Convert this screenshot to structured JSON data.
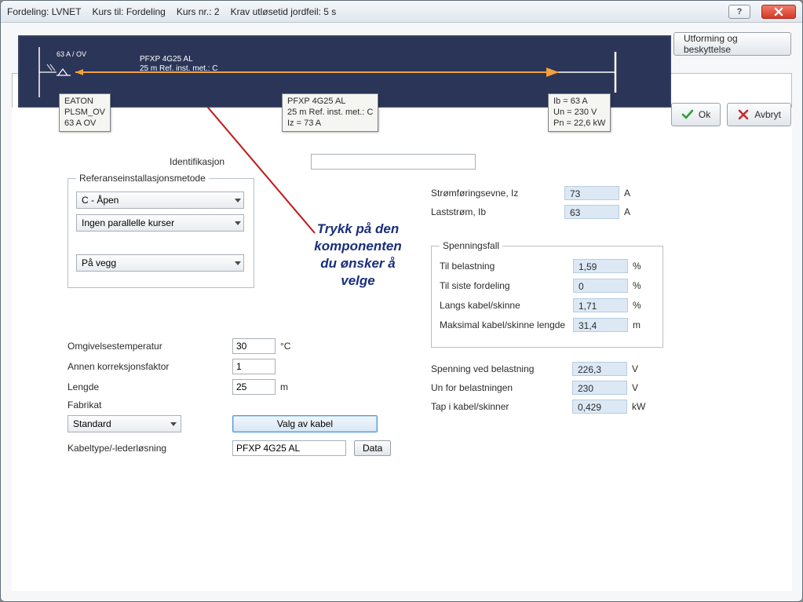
{
  "title_parts": {
    "a": "Fordeling: LVNET",
    "b": "Kurs til: Fordeling",
    "c": "Kurs nr.: 2",
    "d": "Krav utløsetid jordfeil: 5 s"
  },
  "buttons": {
    "utforming": "Utforming og beskyttelse",
    "ok": "Ok",
    "avbryt": "Avbryt",
    "valg_kabel": "Valg av kabel",
    "data": "Data"
  },
  "schematic": {
    "ov_label": "63 A / OV",
    "cable_name": "PFXP 4G25 AL",
    "cable_len_met": "25 m   Ref. inst. met.: C"
  },
  "tooltips": {
    "eaton": {
      "l1": "EATON",
      "l2": "PLSM_OV",
      "l3": "63 A OV"
    },
    "pfxp": {
      "l1": "PFXP 4G25 AL",
      "l2": "25 m   Ref. inst. met.: C",
      "l3": "Iz = 73 A"
    },
    "ib": {
      "l1": "Ib = 63 A",
      "l2": "Un = 230 V",
      "l3": "Pn = 22,6 kW"
    }
  },
  "labels": {
    "identifikasjon": "Identifikasjon",
    "refmetode": "Referanseinstallasjonsmetode",
    "omgivelsestemp": "Omgivelsestemperatur",
    "annen_korr": "Annen korreksjonsfaktor",
    "lengde": "Lengde",
    "fabrikat": "Fabrikat",
    "kabeltype": "Kabeltype/-lederløsning",
    "stromforingsevne": "Strømføringsevne, Iz",
    "laststrom": "Laststrøm, Ib",
    "spenningsfall": "Spenningsfall",
    "til_belastning": "Til belastning",
    "til_siste_fordeling": "Til siste fordeling",
    "langs_kabel": "Langs kabel/skinne",
    "maks_lengde": "Maksimal kabel/skinne lengde",
    "spenning_ved": "Spenning ved belastning",
    "un_for": "Un for belastningen",
    "tap_i_kabel": "Tap i kabel/skinner"
  },
  "combos": {
    "c_apen": "C - Åpen",
    "ingen_parallelle": "Ingen parallelle kurser",
    "pa_vegg": "På vegg",
    "standard": "Standard"
  },
  "values": {
    "identifikasjon": "",
    "omgivelsestemp": "30",
    "omgivelsestemp_unit": "°C",
    "annen_korr": "1",
    "lengde": "25",
    "lengde_unit": "m",
    "kabeltype": "PFXP 4G25 AL",
    "iz": "73",
    "iz_unit": "A",
    "ib": "63",
    "ib_unit": "A",
    "til_belastning": "1,59",
    "til_belastning_unit": "%",
    "til_siste_fordeling": "0",
    "til_siste_fordeling_unit": "%",
    "langs_kabel": "1,71",
    "langs_kabel_unit": "%",
    "maks_lengde": "31,4",
    "maks_lengde_unit": "m",
    "spenning_ved": "226,3",
    "spenning_ved_unit": "V",
    "un_for": "230",
    "un_for_unit": "V",
    "tap_i_kabel": "0,429",
    "tap_i_kabel_unit": "kW"
  },
  "annotation": {
    "l1": "Trykk på den",
    "l2": "komponenten",
    "l3": "du ønsker å",
    "l4": "velge"
  }
}
